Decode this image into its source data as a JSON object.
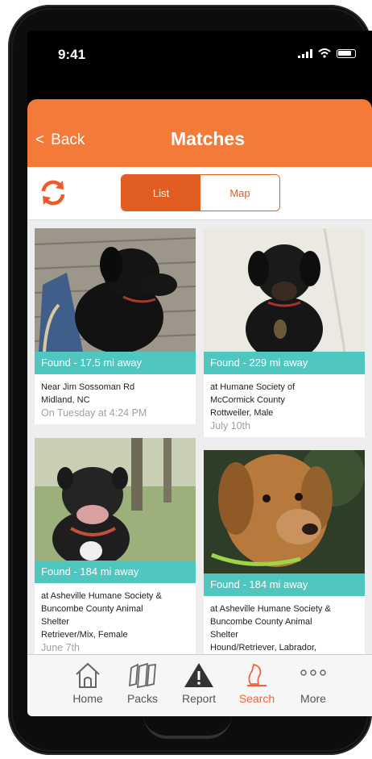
{
  "status": {
    "time": "9:41"
  },
  "header": {
    "back_label": "Back",
    "title": "Matches"
  },
  "toolbar": {
    "list_label": "List",
    "map_label": "Map",
    "selected": "List"
  },
  "cards": [
    {
      "badge": "Found - 17.5 mi away",
      "line1": "Near Jim Sossoman Rd",
      "line2": "Midland, NC",
      "line3": "",
      "line4": "",
      "when": "On Tuesday at 4:24 PM"
    },
    {
      "badge": "Found - 229 mi away",
      "line1": "at Humane Society of",
      "line2": "McCormick County",
      "line3": "Rottweiler, Male",
      "line4": "",
      "when": "July 10th"
    },
    {
      "badge": "Found - 184 mi away",
      "line1": "at Asheville Humane Society &",
      "line2": "Buncombe County Animal",
      "line3": "Shelter",
      "line4": "Retriever/Mix, Female",
      "when": "June 7th"
    },
    {
      "badge": "Found - 184 mi away",
      "line1": "at Asheville Humane Society &",
      "line2": "Buncombe County Animal",
      "line3": "Shelter",
      "line4": "Hound/Retriever, Labrador,",
      "when": ""
    }
  ],
  "tabs": [
    {
      "label": "Home",
      "icon": "home-icon"
    },
    {
      "label": "Packs",
      "icon": "packs-icon"
    },
    {
      "label": "Report",
      "icon": "report-warning-icon"
    },
    {
      "label": "Search",
      "icon": "search-dog-icon"
    },
    {
      "label": "More",
      "icon": "more-dots-icon"
    }
  ],
  "colors": {
    "accent": "#f47a3a",
    "segment": "#e15d22",
    "found_badge": "#4fc6c0",
    "active_tab": "#f4603a"
  }
}
